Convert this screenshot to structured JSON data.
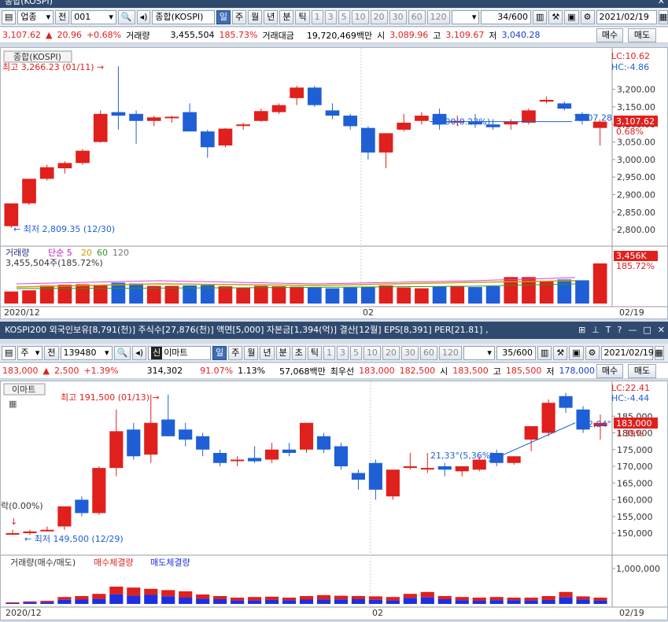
{
  "top": {
    "title": "종합(KOSPI)",
    "toolbar": {
      "market": "업종",
      "prefix": "전",
      "code": "001",
      "name": "종합(KOSPI)",
      "periods": [
        "일",
        "주",
        "월",
        "년",
        "분",
        "틱"
      ],
      "selected_period": "일",
      "numbers": [
        "1",
        "3",
        "5",
        "10",
        "20",
        "30",
        "60",
        "120"
      ],
      "count": "34",
      "count_total": "/600",
      "date": "2021/02/19"
    },
    "quote": {
      "price": "3,107.62",
      "change": "20.96",
      "rate": "+0.68%",
      "vol_label": "거래량",
      "volume": "3,455,504",
      "vol_rate": "185.73%",
      "amt_label": "거래대금",
      "amount": "19,720,469백만",
      "open_label": "시",
      "open": "3,089.96",
      "high_label": "고",
      "high": "3,109.67",
      "low_label": "저",
      "low": "3,040.28",
      "buy": "매수",
      "sell": "매도"
    },
    "chart": {
      "label": "종합(KOSPI)",
      "max_note": "최고 3,266.23 (01/11)",
      "min_note": "최저 2,809.35 (12/30)",
      "last_note": "3,107.28",
      "mid_note": "1,590(0.23%)",
      "lc": "LC:10.62",
      "hc": "HC:-4.86",
      "yticks": [
        "3,200.00",
        "3,150.00",
        "3,100.00",
        "3,050.00",
        "3,000.00",
        "2,950.00",
        "2,900.00",
        "2,850.00",
        "2,800.00"
      ],
      "price_badge": "3,107.62",
      "price_pct": "0.68%",
      "vol_label": "거래량",
      "ma_label": "단순",
      "ma5": "5",
      "ma20": "20",
      "ma60": "60",
      "ma120": "120",
      "vol_value": "3,455,504주(185.72%)",
      "vol_badge": "3,456K",
      "vol_pct": "185.72%",
      "x_left": "2020/12",
      "x_mid": "02",
      "x_right": "02/19"
    }
  },
  "bottom": {
    "title": "KOSPI200 외국인보유[8,791(천)] 주식수[27,876(천)] 액면[5,000] 자본금[1,394(억)] 결산[12월] EPS[8,391] PER[21.81] ,",
    "toolbar": {
      "market": "주",
      "prefix": "전",
      "code": "139480",
      "badge": "신",
      "name": "이마트",
      "periods": [
        "일",
        "주",
        "월",
        "년",
        "분",
        "초",
        "틱"
      ],
      "selected_period": "일",
      "numbers": [
        "1",
        "3",
        "5",
        "10",
        "20",
        "30",
        "60",
        "120"
      ],
      "count": "35",
      "count_total": "/600",
      "date": "2021/02/19"
    },
    "quote": {
      "price": "183,000",
      "change": "2,500",
      "rate": "+1.39%",
      "volume": "314,302",
      "vol_rate": "91.07%",
      "turnover": "1.13%",
      "amount": "57,068백만",
      "best_label": "최우선",
      "ask": "183,000",
      "bid": "182,500",
      "open_label": "시",
      "open": "183,500",
      "high_label": "고",
      "high": "185,500",
      "low_label": "저",
      "low": "178,000",
      "buy": "매수",
      "sell": "매도"
    },
    "chart": {
      "label": "이마트",
      "max_note": "최고 191,500 (01/13)",
      "min_note": "최저 149,500 (12/29)",
      "left_note": "락(0.00%)",
      "trend_note": "21,33°(5,36%)",
      "last_note": "182,94°",
      "lc": "LC:22.41",
      "hc": "HC:-4.44",
      "yticks": [
        "185,000",
        "180,000",
        "175,000",
        "170,000",
        "165,000",
        "160,000",
        "155,000",
        "150,000"
      ],
      "price_badge": "183,000",
      "price_pct": "1.39%",
      "vol_label": "거래량(매수/매도)",
      "buy_vol": "매수체결량",
      "sell_vol": "매도체결량",
      "vol_tick": "1,000,000",
      "x_left": "2020/12",
      "x_mid": "02",
      "x_right": "02/19"
    }
  },
  "colors": {
    "up": "#e0201c",
    "down": "#1f5fd6",
    "titlebar": "#2f4a6e",
    "accent": "#3e6eb3"
  },
  "chart_data": [
    {
      "type": "candlestick",
      "title": "종합(KOSPI)",
      "ylim": [
        2780,
        3300
      ],
      "candles": [
        {
          "o": 2810,
          "h": 2830,
          "l": 2805,
          "c": 2875
        },
        {
          "o": 2875,
          "h": 2880,
          "l": 2870,
          "c": 2945
        },
        {
          "o": 2945,
          "h": 2985,
          "l": 2940,
          "c": 2978
        },
        {
          "o": 2975,
          "h": 2995,
          "l": 2960,
          "c": 2990
        },
        {
          "o": 2990,
          "h": 3030,
          "l": 2985,
          "c": 3025
        },
        {
          "o": 3050,
          "h": 3140,
          "l": 3048,
          "c": 3130
        },
        {
          "o": 3135,
          "h": 3266,
          "l": 3085,
          "c": 3125
        },
        {
          "o": 3130,
          "h": 3140,
          "l": 3045,
          "c": 3110
        },
        {
          "o": 3110,
          "h": 3125,
          "l": 3095,
          "c": 3120
        },
        {
          "o": 3118,
          "h": 3125,
          "l": 3105,
          "c": 3122
        },
        {
          "o": 3135,
          "h": 3160,
          "l": 3080,
          "c": 3080
        },
        {
          "o": 3080,
          "h": 3085,
          "l": 3005,
          "c": 3035
        },
        {
          "o": 3040,
          "h": 3090,
          "l": 3035,
          "c": 3088
        },
        {
          "o": 3100,
          "h": 3105,
          "l": 3085,
          "c": 3100
        },
        {
          "o": 3110,
          "h": 3145,
          "l": 3108,
          "c": 3138
        },
        {
          "o": 3135,
          "h": 3160,
          "l": 3130,
          "c": 3155
        },
        {
          "o": 3175,
          "h": 3210,
          "l": 3155,
          "c": 3205
        },
        {
          "o": 3205,
          "h": 3210,
          "l": 3150,
          "c": 3155
        },
        {
          "o": 3140,
          "h": 3160,
          "l": 3115,
          "c": 3125
        },
        {
          "o": 3125,
          "h": 3130,
          "l": 3085,
          "c": 3095
        },
        {
          "o": 3090,
          "h": 3095,
          "l": 3000,
          "c": 3020
        },
        {
          "o": 3020,
          "h": 3050,
          "l": 2975,
          "c": 3075
        },
        {
          "o": 3085,
          "h": 3130,
          "l": 3080,
          "c": 3105
        },
        {
          "o": 3110,
          "h": 3135,
          "l": 3100,
          "c": 3125
        },
        {
          "o": 3130,
          "h": 3145,
          "l": 3085,
          "c": 3100
        },
        {
          "o": 3105,
          "h": 3125,
          "l": 3095,
          "c": 3110
        },
        {
          "o": 3108,
          "h": 3130,
          "l": 3090,
          "c": 3100
        },
        {
          "o": 3100,
          "h": 3115,
          "l": 3085,
          "c": 3092
        },
        {
          "o": 3100,
          "h": 3115,
          "l": 3085,
          "c": 3108
        },
        {
          "o": 3105,
          "h": 3145,
          "l": 3100,
          "c": 3140
        },
        {
          "o": 3165,
          "h": 3180,
          "l": 3160,
          "c": 3170
        },
        {
          "o": 3160,
          "h": 3165,
          "l": 3140,
          "c": 3145
        },
        {
          "o": 3130,
          "h": 3135,
          "l": 3100,
          "c": 3110
        },
        {
          "o": 3090,
          "h": 3110,
          "l": 3040,
          "c": 3108
        }
      ],
      "volumes": [
        0.3,
        0.33,
        0.45,
        0.47,
        0.48,
        0.47,
        0.52,
        0.5,
        0.44,
        0.44,
        0.45,
        0.46,
        0.43,
        0.4,
        0.44,
        0.43,
        0.42,
        0.4,
        0.38,
        0.4,
        0.42,
        0.45,
        0.4,
        0.38,
        0.42,
        0.44,
        0.41,
        0.43,
        0.66,
        0.66,
        0.55,
        0.6,
        0.58,
        1.0
      ]
    },
    {
      "type": "candlestick",
      "title": "이마트",
      "ylim": [
        146000,
        194000
      ],
      "candles": [
        {
          "o": 150000,
          "h": 151000,
          "l": 149500,
          "c": 150000
        },
        {
          "o": 150000,
          "h": 151000,
          "l": 149500,
          "c": 150500
        },
        {
          "o": 151000,
          "h": 152000,
          "l": 150500,
          "c": 151000
        },
        {
          "o": 152000,
          "h": 158000,
          "l": 151000,
          "c": 158000
        },
        {
          "o": 160000,
          "h": 161000,
          "l": 155000,
          "c": 156000
        },
        {
          "o": 156000,
          "h": 170000,
          "l": 155500,
          "c": 169500
        },
        {
          "o": 169500,
          "h": 187000,
          "l": 167000,
          "c": 180500
        },
        {
          "o": 181000,
          "h": 183000,
          "l": 172000,
          "c": 173000
        },
        {
          "o": 173500,
          "h": 191500,
          "l": 171000,
          "c": 183000
        },
        {
          "o": 184000,
          "h": 191500,
          "l": 179000,
          "c": 179000
        },
        {
          "o": 181000,
          "h": 183000,
          "l": 176000,
          "c": 178000
        },
        {
          "o": 179000,
          "h": 180000,
          "l": 173000,
          "c": 175000
        },
        {
          "o": 174000,
          "h": 175000,
          "l": 170000,
          "c": 171000
        },
        {
          "o": 172000,
          "h": 173000,
          "l": 170000,
          "c": 172000
        },
        {
          "o": 172500,
          "h": 176000,
          "l": 171000,
          "c": 171500
        },
        {
          "o": 172000,
          "h": 177000,
          "l": 171000,
          "c": 175000
        },
        {
          "o": 175000,
          "h": 177000,
          "l": 173000,
          "c": 174000
        },
        {
          "o": 175000,
          "h": 183000,
          "l": 174000,
          "c": 183000
        },
        {
          "o": 179000,
          "h": 180000,
          "l": 174000,
          "c": 175000
        },
        {
          "o": 176000,
          "h": 177000,
          "l": 169000,
          "c": 170000
        },
        {
          "o": 168000,
          "h": 169000,
          "l": 163000,
          "c": 166000
        },
        {
          "o": 171000,
          "h": 172000,
          "l": 160000,
          "c": 163000
        },
        {
          "o": 161000,
          "h": 169000,
          "l": 160000,
          "c": 169000
        },
        {
          "o": 169500,
          "h": 174000,
          "l": 169000,
          "c": 170000
        },
        {
          "o": 169500,
          "h": 174000,
          "l": 168000,
          "c": 169500
        },
        {
          "o": 170000,
          "h": 171000,
          "l": 167000,
          "c": 169000
        },
        {
          "o": 168500,
          "h": 170000,
          "l": 167000,
          "c": 170000
        },
        {
          "o": 169000,
          "h": 173000,
          "l": 168500,
          "c": 172000
        },
        {
          "o": 174000,
          "h": 175000,
          "l": 170000,
          "c": 171000
        },
        {
          "o": 171000,
          "h": 173000,
          "l": 170500,
          "c": 173000
        },
        {
          "o": 178000,
          "h": 180000,
          "l": 174500,
          "c": 182000
        },
        {
          "o": 180000,
          "h": 190000,
          "l": 179000,
          "c": 189000
        },
        {
          "o": 191000,
          "h": 192000,
          "l": 186000,
          "c": 187500
        },
        {
          "o": 187000,
          "h": 188000,
          "l": 180000,
          "c": 181000
        },
        {
          "o": 182000,
          "h": 185500,
          "l": 178000,
          "c": 183000
        }
      ],
      "volumes": [
        0.05,
        0.08,
        0.1,
        0.22,
        0.25,
        0.32,
        0.55,
        0.52,
        0.48,
        0.44,
        0.4,
        0.3,
        0.25,
        0.2,
        0.22,
        0.23,
        0.2,
        0.25,
        0.28,
        0.26,
        0.25,
        0.24,
        0.22,
        0.32,
        0.38,
        0.25,
        0.22,
        0.2,
        0.22,
        0.2,
        0.2,
        0.25,
        0.38,
        0.24,
        0.2
      ],
      "buy_share": [
        0.5,
        0.6,
        0.55,
        0.6,
        0.55,
        0.5,
        0.55,
        0.5,
        0.6,
        0.55,
        0.5,
        0.55,
        0.6,
        0.55,
        0.5,
        0.55,
        0.6,
        0.55,
        0.5,
        0.55,
        0.6,
        0.55,
        0.5,
        0.6,
        0.55,
        0.6,
        0.55,
        0.5,
        0.55,
        0.6,
        0.55,
        0.5,
        0.55,
        0.6,
        0.55
      ]
    }
  ]
}
